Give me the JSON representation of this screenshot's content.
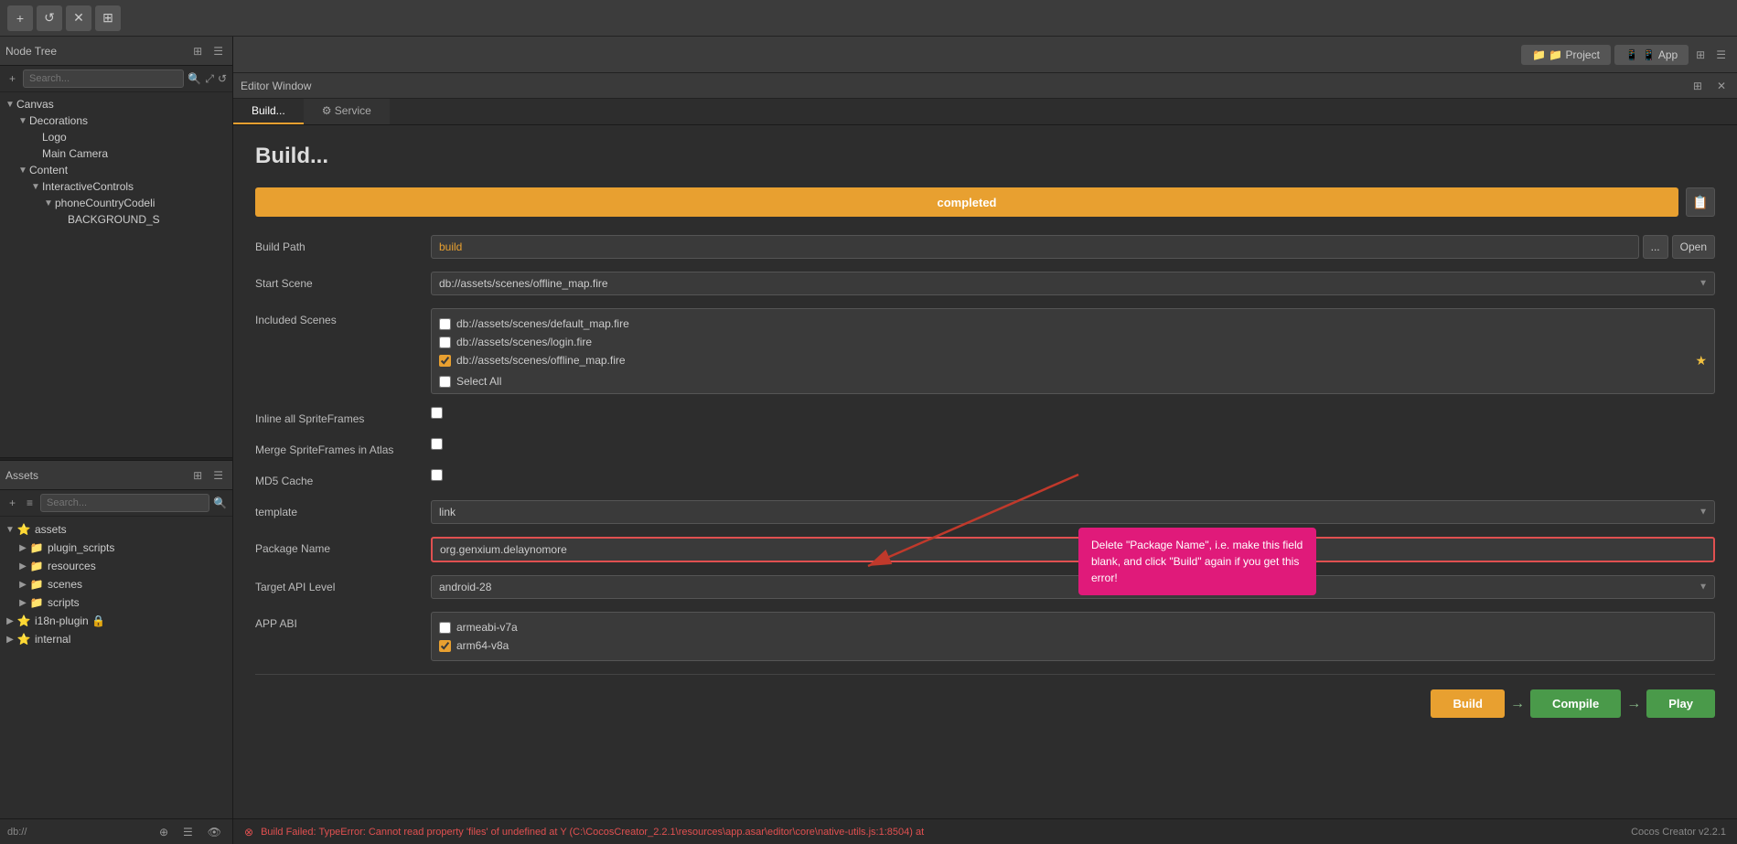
{
  "topbar": {
    "buttons": [
      "+",
      "↺",
      "✕",
      "⊞"
    ]
  },
  "nodeTree": {
    "title": "Node Tree",
    "search_placeholder": "Search...",
    "items": [
      {
        "label": "Canvas",
        "indent": 0,
        "arrow": "▼",
        "has_arrow": true
      },
      {
        "label": "Decorations",
        "indent": 1,
        "arrow": "▼",
        "has_arrow": true
      },
      {
        "label": "Logo",
        "indent": 2,
        "arrow": "",
        "has_arrow": false
      },
      {
        "label": "Main Camera",
        "indent": 2,
        "arrow": "",
        "has_arrow": false
      },
      {
        "label": "Content",
        "indent": 1,
        "arrow": "▼",
        "has_arrow": true
      },
      {
        "label": "InteractiveControls",
        "indent": 2,
        "arrow": "▼",
        "has_arrow": true
      },
      {
        "label": "phoneCountryCodeli",
        "indent": 3,
        "arrow": "▼",
        "has_arrow": true
      },
      {
        "label": "BACKGROUND_S",
        "indent": 4,
        "arrow": "",
        "has_arrow": false
      }
    ]
  },
  "assets": {
    "title": "Assets",
    "search_placeholder": "Search...",
    "items": [
      {
        "label": "assets",
        "indent": 0,
        "icon": "special",
        "has_arrow": true,
        "arrow": "▼"
      },
      {
        "label": "plugin_scripts",
        "indent": 1,
        "icon": "folder",
        "has_arrow": true,
        "arrow": "▶"
      },
      {
        "label": "resources",
        "indent": 1,
        "icon": "folder",
        "has_arrow": true,
        "arrow": "▶"
      },
      {
        "label": "scenes",
        "indent": 1,
        "icon": "folder",
        "has_arrow": true,
        "arrow": "▶"
      },
      {
        "label": "scripts",
        "indent": 1,
        "icon": "folder",
        "has_arrow": true,
        "arrow": "▶"
      },
      {
        "label": "i18n-plugin 🔒",
        "indent": 0,
        "icon": "special",
        "has_arrow": true,
        "arrow": "▶"
      },
      {
        "label": "internal",
        "indent": 0,
        "icon": "special",
        "has_arrow": true,
        "arrow": "▶"
      }
    ]
  },
  "statusbar_left": "db://",
  "right_tabs": [
    {
      "label": "📁 Project"
    },
    {
      "label": "📱 App"
    }
  ],
  "editor_window_title": "Editor Window",
  "tabs": [
    {
      "label": "Build...",
      "active": true
    },
    {
      "label": "⚙ Service",
      "active": false
    }
  ],
  "build": {
    "title": "Build...",
    "progress": {
      "label": "completed",
      "icon": "📋"
    },
    "form": {
      "build_path_label": "Build Path",
      "build_path_value": "build",
      "build_path_btn_dots": "...",
      "build_path_btn_open": "Open",
      "start_scene_label": "Start Scene",
      "start_scene_value": "db://assets/scenes/offline_map.fire",
      "included_scenes_label": "Included Scenes",
      "scenes": [
        {
          "label": "db://assets/scenes/default_map.fire",
          "checked": false
        },
        {
          "label": "db://assets/scenes/login.fire",
          "checked": false
        },
        {
          "label": "db://assets/scenes/offline_map.fire",
          "checked": true,
          "star": true
        }
      ],
      "select_all_label": "Select All",
      "inline_spriteframes_label": "Inline all SpriteFrames",
      "inline_spriteframes_checked": false,
      "merge_spriteframes_label": "Merge SpriteFrames in Atlas",
      "merge_spriteframes_checked": false,
      "md5_cache_label": "MD5 Cache",
      "md5_cache_checked": false,
      "template_label": "template",
      "template_value": "link",
      "package_name_label": "Package Name",
      "package_name_value": "org.genxium.delaynomore",
      "target_api_label": "Target API Level",
      "target_api_value": "android-28",
      "app_abi_label": "APP ABI",
      "abi_options": [
        {
          "label": "armeabi-v7a",
          "checked": false
        },
        {
          "label": "arm64-v8a",
          "checked": true
        }
      ]
    },
    "annotation": "Delete \"Package Name\", i.e. make this field blank, and click \"Build\" again if you get this error!",
    "actions": {
      "build_label": "Build",
      "compile_label": "Compile",
      "play_label": "Play"
    }
  },
  "bottom_status": {
    "error_icon": "⊗",
    "error_text": "Build Failed: TypeError: Cannot read property 'files' of undefined at Y (C:\\CocosCreator_2.2.1\\resources\\app.asar\\editor\\core\\native-utils.js:1:8504) at",
    "version": "Cocos Creator v2.2.1"
  }
}
